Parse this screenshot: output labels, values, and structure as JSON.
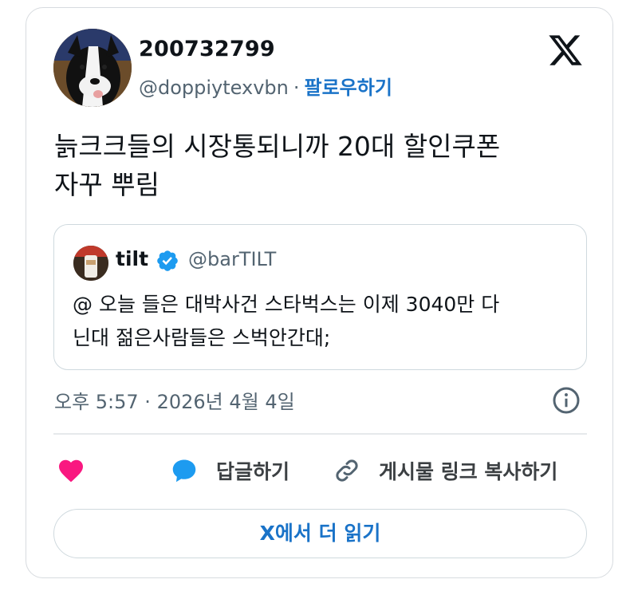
{
  "author": {
    "display_name": "200732799",
    "handle": "@doppiytexvbn",
    "separator": "·",
    "follow_label": "팔로우하기"
  },
  "tweet": {
    "text": "늙크크들의 시장통되니까  20대 할인쿠폰\n자꾸 뿌림"
  },
  "quote": {
    "name": "tilt",
    "handle": "@barTILT",
    "text": "@ 오늘 들은 대박사건 스타벅스는 이제 3040만 다\n닌대 젊은사람들은 스벅안간대;"
  },
  "meta": {
    "timestamp": "오후 5:57 · 2026년 4월 4일"
  },
  "actions": {
    "reply_label": "답글하기",
    "copy_link_label": "게시물 링크 복사하기"
  },
  "read_more_label": "X에서 더 읽기",
  "colors": {
    "accent_blue": "#1a73c8",
    "like_pink": "#f91880",
    "reply_blue": "#1d9bf0",
    "verified_blue": "#1d9bf0",
    "secondary_text": "#536471",
    "border": "#cfd9de"
  },
  "icons": [
    "x-logo-icon",
    "verified-badge-icon",
    "info-icon",
    "heart-icon",
    "reply-icon",
    "link-icon"
  ]
}
